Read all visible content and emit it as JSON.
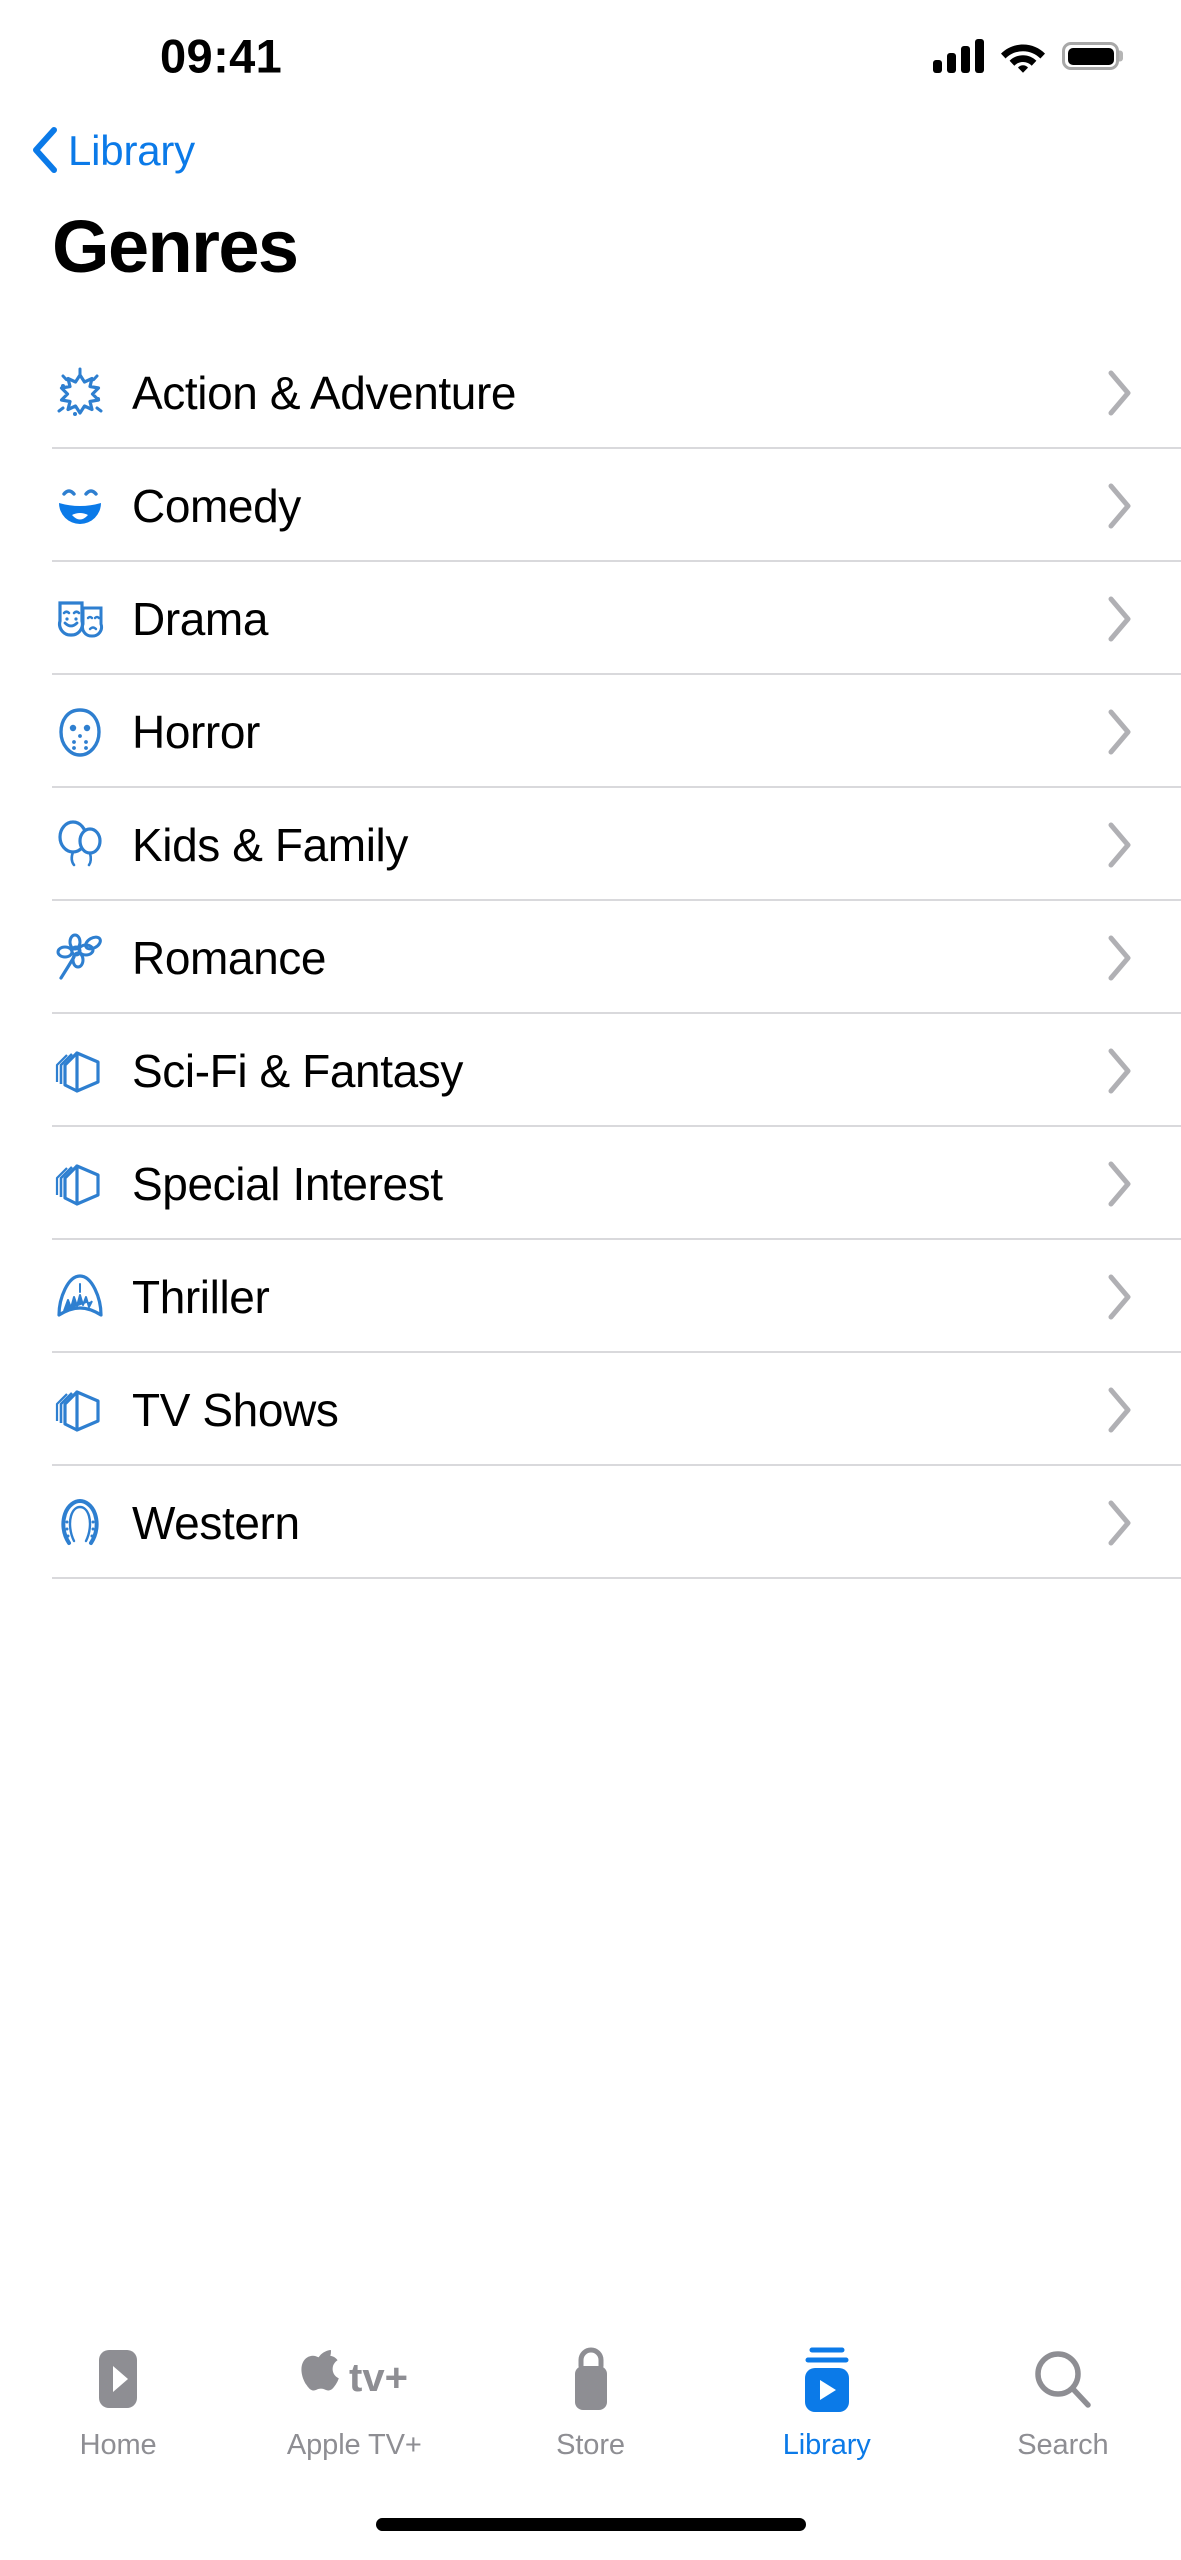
{
  "status_bar": {
    "time": "09:41",
    "signal_icon": "cellular-signal-icon",
    "wifi_icon": "wifi-icon",
    "battery_icon": "battery-full-icon"
  },
  "nav": {
    "back_label": "Library",
    "back_icon": "chevron-left-icon"
  },
  "header": {
    "title": "Genres"
  },
  "list": {
    "disclosure_icon": "chevron-right-icon",
    "items": [
      {
        "label": "Action & Adventure",
        "icon": "starburst-icon"
      },
      {
        "label": "Comedy",
        "icon": "laughing-face-icon"
      },
      {
        "label": "Drama",
        "icon": "theater-masks-icon"
      },
      {
        "label": "Horror",
        "icon": "hockey-mask-icon"
      },
      {
        "label": "Kids & Family",
        "icon": "balloons-icon"
      },
      {
        "label": "Romance",
        "icon": "flower-icon"
      },
      {
        "label": "Sci-Fi & Fantasy",
        "icon": "layered-cube-icon"
      },
      {
        "label": "Special Interest",
        "icon": "layered-cube-icon"
      },
      {
        "label": "Thriller",
        "icon": "shark-icon"
      },
      {
        "label": "TV Shows",
        "icon": "layered-cube-icon"
      },
      {
        "label": "Western",
        "icon": "horseshoe-icon"
      }
    ]
  },
  "tab_bar": {
    "items": [
      {
        "label": "Home",
        "icon": "play-rect-icon",
        "active": false
      },
      {
        "label": "Apple TV+",
        "icon": "apple-tv-plus-icon",
        "active": false
      },
      {
        "label": "Store",
        "icon": "shopping-bag-icon",
        "active": false
      },
      {
        "label": "Library",
        "icon": "library-icon",
        "active": true
      },
      {
        "label": "Search",
        "icon": "magnifier-icon",
        "active": false
      }
    ]
  },
  "colors": {
    "accent": "#0b7ae8",
    "icon_blue": "#2e7fd0",
    "inactive_tab": "#8e8e93",
    "separator": "#d9d9dc",
    "background": "#ffffff",
    "text": "#000000"
  }
}
